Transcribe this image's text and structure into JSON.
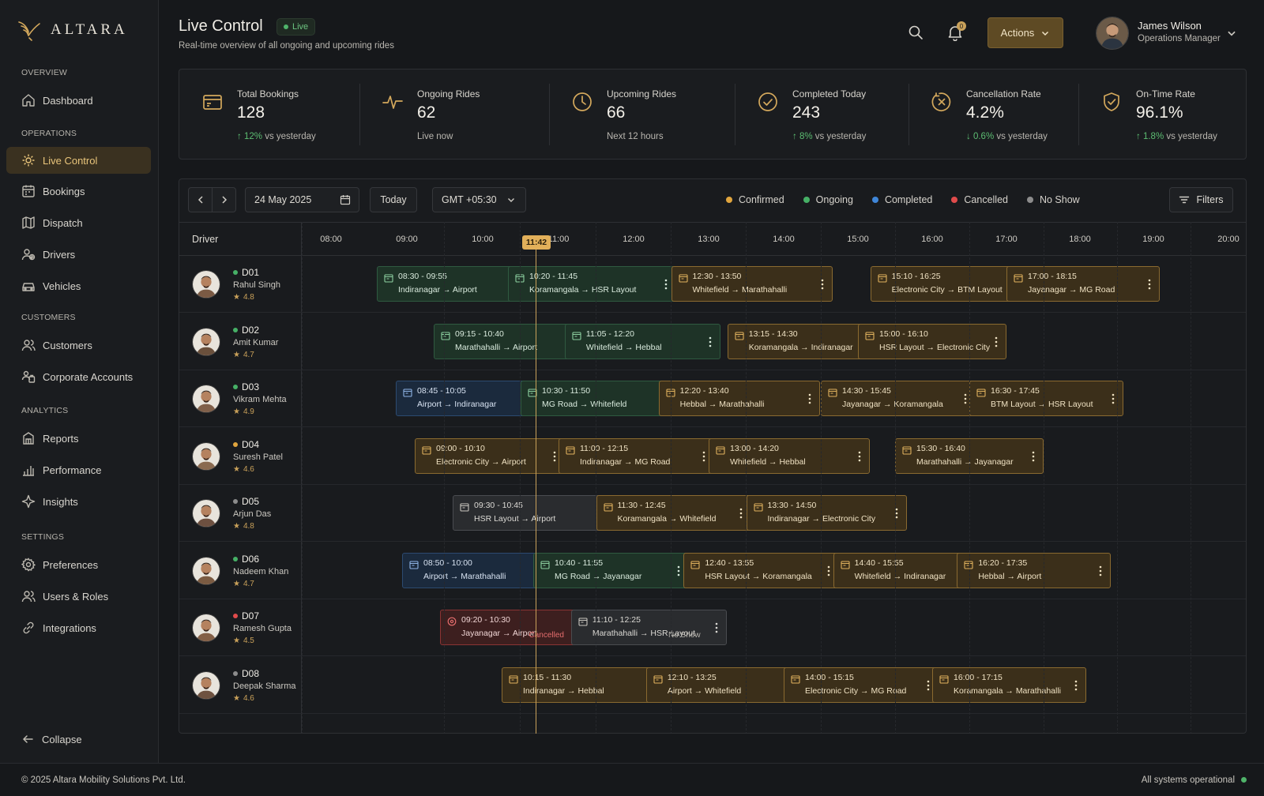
{
  "brand": {
    "name": "ALTARA"
  },
  "sidebar": {
    "sections": [
      {
        "label": "OVERVIEW",
        "items": [
          {
            "label": "Dashboard",
            "icon": "home-icon"
          }
        ]
      },
      {
        "label": "OPERATIONS",
        "items": [
          {
            "label": "Live Control",
            "icon": "live-control-icon",
            "active": true
          },
          {
            "label": "Bookings",
            "icon": "calendar-icon"
          },
          {
            "label": "Dispatch",
            "icon": "dispatch-icon"
          },
          {
            "label": "Drivers",
            "icon": "drivers-icon"
          },
          {
            "label": "Vehicles",
            "icon": "car-icon"
          }
        ]
      },
      {
        "label": "CUSTOMERS",
        "items": [
          {
            "label": "Customers",
            "icon": "users-icon"
          },
          {
            "label": "Corporate Accounts",
            "icon": "corporate-icon"
          }
        ]
      },
      {
        "label": "ANALYTICS",
        "items": [
          {
            "label": "Reports",
            "icon": "reports-icon"
          },
          {
            "label": "Performance",
            "icon": "bar-chart-icon"
          },
          {
            "label": "Insights",
            "icon": "sparkle-icon"
          }
        ]
      },
      {
        "label": "SETTINGS",
        "items": [
          {
            "label": "Preferences",
            "icon": "gear-icon"
          },
          {
            "label": "Users & Roles",
            "icon": "users-roles-icon"
          },
          {
            "label": "Integrations",
            "icon": "link-icon"
          }
        ]
      }
    ],
    "collapse_label": "Collapse"
  },
  "header": {
    "title": "Live Control",
    "live_badge": "Live",
    "subtitle": "Real-time overview of all ongoing and upcoming rides",
    "notification_count": "0",
    "actions_label": "Actions",
    "user": {
      "name": "James Wilson",
      "role": "Operations Manager"
    }
  },
  "stats": [
    {
      "label": "Total Bookings",
      "value": "128",
      "delta": "12%",
      "delta_dir": "up",
      "suffix": "vs yesterday",
      "icon": "booking-card-icon"
    },
    {
      "label": "Ongoing Rides",
      "value": "62",
      "note": "Live now",
      "icon": "pulse-icon"
    },
    {
      "label": "Upcoming Rides",
      "value": "66",
      "note": "Next 12 hours",
      "icon": "clock-icon"
    },
    {
      "label": "Completed Today",
      "value": "243",
      "delta": "8%",
      "delta_dir": "up",
      "suffix": "vs yesterday",
      "icon": "check-circle-icon"
    },
    {
      "label": "Cancellation Rate",
      "value": "4.2%",
      "delta": "0.6%",
      "delta_dir": "down",
      "suffix": "vs yesterday",
      "icon": "cancel-circle-icon"
    },
    {
      "label": "On-Time Rate",
      "value": "96.1%",
      "delta": "1.8%",
      "delta_dir": "up",
      "suffix": "vs yesterday",
      "icon": "shield-check-icon"
    }
  ],
  "toolbar": {
    "date": "24 May 2025",
    "today_label": "Today",
    "timezone": "GMT +05:30",
    "filters_label": "Filters",
    "legend": [
      {
        "label": "Confirmed",
        "color": "#e0a53e"
      },
      {
        "label": "Ongoing",
        "color": "#46b066"
      },
      {
        "label": "Completed",
        "color": "#3f86d8"
      },
      {
        "label": "Cancelled",
        "color": "#e04b4b"
      },
      {
        "label": "No Show",
        "color": "#8c8c8c"
      }
    ]
  },
  "timeline": {
    "driver_col_label": "Driver",
    "ticks": [
      "08:00",
      "09:00",
      "10:00",
      "11:00",
      "12:00",
      "13:00",
      "14:00",
      "15:00",
      "16:00",
      "17:00",
      "18:00",
      "19:00",
      "20:00"
    ],
    "now": "11:42"
  },
  "drivers": [
    {
      "code": "D01",
      "name": "Rahul Singh",
      "rating": "4.8",
      "status_color": "#46b066",
      "rides": [
        {
          "time": "08:30 - 09:55",
          "from": "Indiranagar",
          "to": "Airport",
          "status": "ongoing"
        },
        {
          "time": "10:20 - 11:45",
          "from": "Koramangala",
          "to": "HSR Layout",
          "status": "ongoing"
        },
        {
          "time": "12:30 - 13:50",
          "from": "Whitefield",
          "to": "Marathahalli",
          "status": "confirmed"
        },
        {
          "time": "15:10 - 16:25",
          "from": "Electronic City",
          "to": "BTM Layout",
          "status": "confirmed"
        },
        {
          "time": "17:00 - 18:15",
          "from": "Jayanagar",
          "to": "MG Road",
          "status": "confirmed"
        }
      ]
    },
    {
      "code": "D02",
      "name": "Amit Kumar",
      "rating": "4.7",
      "status_color": "#46b066",
      "rides": [
        {
          "time": "09:15 - 10:40",
          "from": "Marathahalli",
          "to": "Airport",
          "status": "ongoing"
        },
        {
          "time": "11:05 - 12:20",
          "from": "Whitefield",
          "to": "Hebbal",
          "status": "ongoing"
        },
        {
          "time": "13:15 - 14:30",
          "from": "Koramangala",
          "to": "Indiranagar",
          "status": "confirmed"
        },
        {
          "time": "15:00 - 16:10",
          "from": "HSR Layout",
          "to": "Electronic City",
          "status": "confirmed"
        }
      ]
    },
    {
      "code": "D03",
      "name": "Vikram Mehta",
      "rating": "4.9",
      "status_color": "#46b066",
      "rides": [
        {
          "time": "08:45 - 10:05",
          "from": "Airport",
          "to": "Indiranagar",
          "status": "completed"
        },
        {
          "time": "10:30 - 11:50",
          "from": "MG Road",
          "to": "Whitefield",
          "status": "ongoing"
        },
        {
          "time": "12:20 - 13:40",
          "from": "Hebbal",
          "to": "Marathahalli",
          "status": "confirmed"
        },
        {
          "time": "14:30 - 15:45",
          "from": "Jayanagar",
          "to": "Koramangala",
          "status": "confirmed"
        },
        {
          "time": "16:30 - 17:45",
          "from": "BTM Layout",
          "to": "HSR Layout",
          "status": "confirmed"
        }
      ]
    },
    {
      "code": "D04",
      "name": "Suresh Patel",
      "rating": "4.6",
      "status_color": "#e0a53e",
      "rides": [
        {
          "time": "09:00 - 10:10",
          "from": "Electronic City",
          "to": "Airport",
          "status": "confirmed"
        },
        {
          "time": "11:00 - 12:15",
          "from": "Indiranagar",
          "to": "MG Road",
          "status": "confirmed"
        },
        {
          "time": "13:00 - 14:20",
          "from": "Whitefield",
          "to": "Hebbal",
          "status": "confirmed"
        },
        {
          "time": "15:30 - 16:40",
          "from": "Marathahalli",
          "to": "Jayanagar",
          "status": "confirmed"
        }
      ]
    },
    {
      "code": "D05",
      "name": "Arjun Das",
      "rating": "4.8",
      "status_color": "#8c8c8c",
      "rides": [
        {
          "time": "09:30 - 10:45",
          "from": "HSR Layout",
          "to": "Airport",
          "status": "noshow"
        },
        {
          "time": "11:30 - 12:45",
          "from": "Koramangala",
          "to": "Whitefield",
          "status": "confirmed"
        },
        {
          "time": "13:30 - 14:50",
          "from": "Indiranagar",
          "to": "Electronic City",
          "status": "confirmed"
        }
      ]
    },
    {
      "code": "D06",
      "name": "Nadeem Khan",
      "rating": "4.7",
      "status_color": "#46b066",
      "rides": [
        {
          "time": "08:50 - 10:00",
          "from": "Airport",
          "to": "Marathahalli",
          "status": "completed"
        },
        {
          "time": "10:40 - 11:55",
          "from": "MG Road",
          "to": "Jayanagar",
          "status": "ongoing"
        },
        {
          "time": "12:40 - 13:55",
          "from": "HSR Layout",
          "to": "Koramangala",
          "status": "confirmed"
        },
        {
          "time": "14:40 - 15:55",
          "from": "Whitefield",
          "to": "Indiranagar",
          "status": "confirmed"
        },
        {
          "time": "16:20 - 17:35",
          "from": "Hebbal",
          "to": "Airport",
          "status": "confirmed"
        }
      ]
    },
    {
      "code": "D07",
      "name": "Ramesh Gupta",
      "rating": "4.5",
      "status_color": "#e04b4b",
      "rides": [
        {
          "time": "09:20 - 10:30",
          "from": "Jayanagar",
          "to": "Airport",
          "status": "cancelled",
          "tag": "Cancelled"
        },
        {
          "time": "11:10 - 12:25",
          "from": "Marathahalli",
          "to": "HSR Layout",
          "status": "noshow",
          "tag": "No Show"
        }
      ]
    },
    {
      "code": "D08",
      "name": "Deepak Sharma",
      "rating": "4.6",
      "status_color": "#8c8c8c",
      "rides": [
        {
          "time": "10:15 - 11:30",
          "from": "Indiranagar",
          "to": "Hebbal",
          "status": "confirmed"
        },
        {
          "time": "12:10 - 13:25",
          "from": "Airport",
          "to": "Whitefield",
          "status": "confirmed"
        },
        {
          "time": "14:00 - 15:15",
          "from": "Electronic City",
          "to": "MG Road",
          "status": "confirmed"
        },
        {
          "time": "16:00 - 17:15",
          "from": "Koramangala",
          "to": "Marathahalli",
          "status": "confirmed"
        }
      ]
    }
  ],
  "footer": {
    "copyright": "© 2025 Altara Mobility Solutions Pvt. Ltd.",
    "status": "All systems operational"
  }
}
